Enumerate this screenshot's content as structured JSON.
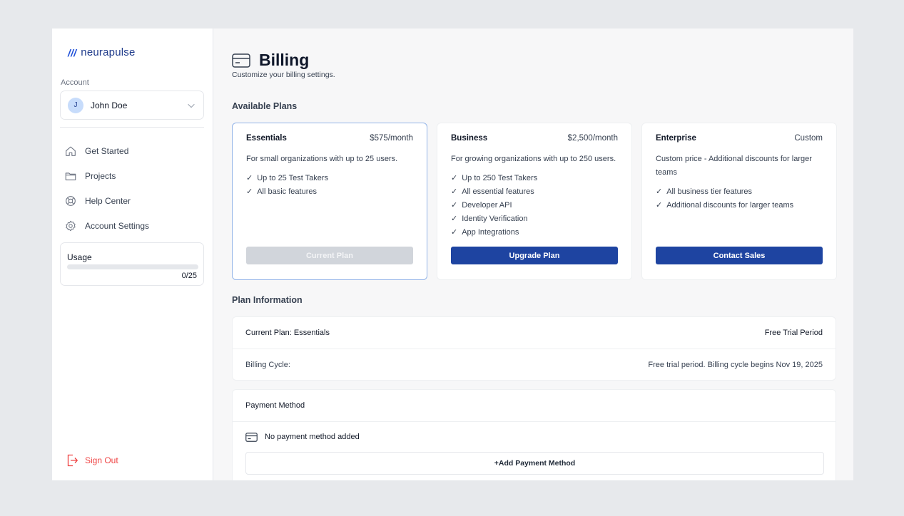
{
  "brand": {
    "name": "neurapulse",
    "mark": "///"
  },
  "sidebar": {
    "account_label": "Account",
    "account": {
      "initial": "J",
      "name": "John Doe"
    },
    "items": [
      {
        "label": "Get Started",
        "icon": "home-icon"
      },
      {
        "label": "Projects",
        "icon": "folder-icon"
      },
      {
        "label": "Help Center",
        "icon": "lifebuoy-icon"
      },
      {
        "label": "Account Settings",
        "icon": "gear-icon"
      }
    ],
    "usage": {
      "title": "Usage",
      "count": "0/25",
      "progress": 0
    },
    "sign_out": "Sign Out"
  },
  "page": {
    "title": "Billing",
    "subtitle": "Customize your billing settings."
  },
  "plans_section": {
    "title": "Available Plans",
    "plans": [
      {
        "name": "Essentials",
        "price": "$575/month",
        "description": "For small organizations with up to 25 users.",
        "features": [
          "Up to 25 Test Takers",
          "All basic features"
        ],
        "button": "Current Plan",
        "current": true
      },
      {
        "name": "Business",
        "price": "$2,500/month",
        "description": "For growing organizations with up to 250 users.",
        "features": [
          "Up to 250 Test Takers",
          "All essential features",
          "Developer API",
          "Identity Verification",
          "App Integrations"
        ],
        "button": "Upgrade Plan",
        "current": false
      },
      {
        "name": "Enterprise",
        "price": "Custom",
        "description": "Custom price - Additional discounts for larger teams",
        "features": [
          "All business tier features",
          "Additional discounts for larger teams"
        ],
        "button": "Contact Sales",
        "current": false
      }
    ]
  },
  "plan_info": {
    "title": "Plan Information",
    "current_plan": "Current Plan: Essentials",
    "status": "Free Trial Period",
    "billing_cycle_label": "Billing Cycle:",
    "billing_cycle_value": "Free trial period. Billing cycle begins Nov 19, 2025"
  },
  "payment": {
    "title": "Payment Method",
    "empty": "No payment method added",
    "add_button": "+Add Payment Method"
  },
  "colors": {
    "accent": "#1e44a1",
    "danger": "#ef4444",
    "current_border": "#93b4e8",
    "background": "#e7e9ec"
  }
}
